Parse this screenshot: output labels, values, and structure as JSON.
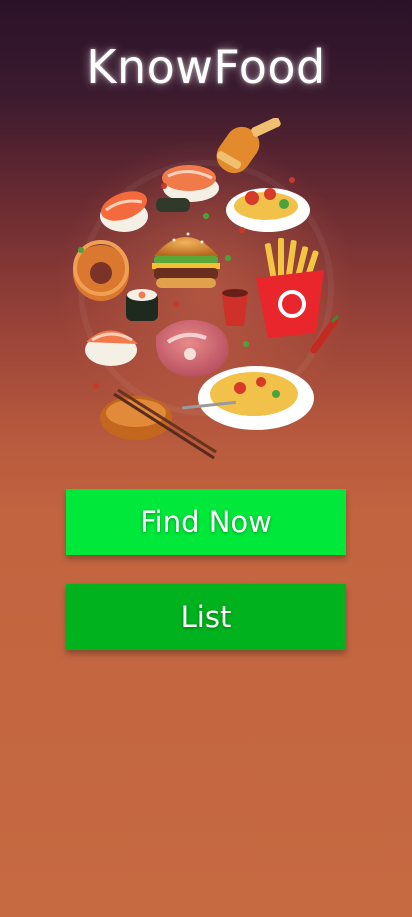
{
  "app": {
    "title": "KnowFood"
  },
  "hero": {
    "icon": "food-collage-illustration"
  },
  "buttons": {
    "find_now_label": "Find Now",
    "list_label": "List"
  },
  "colors": {
    "find_now_bg": "#00e83a",
    "list_bg": "#00b21d",
    "background_top": "#2b1228",
    "background_bottom": "#c66a42"
  }
}
